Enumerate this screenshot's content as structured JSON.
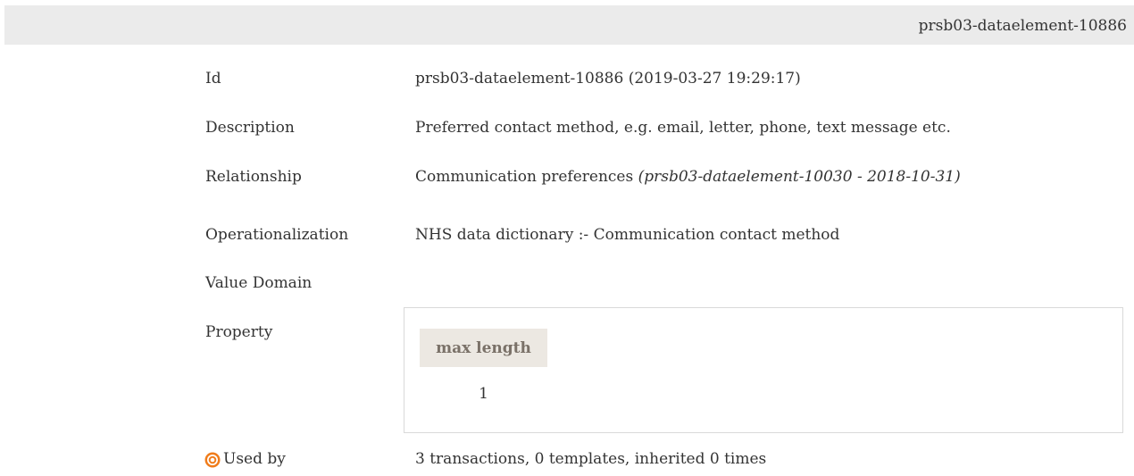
{
  "header": {
    "title": "prsb03-dataelement-10886"
  },
  "fields": {
    "id": {
      "label": "Id",
      "value": "prsb03-dataelement-10886 (2019-03-27 19:29:17)"
    },
    "description": {
      "label": "Description",
      "value": "Preferred contact method, e.g. email, letter, phone, text message etc."
    },
    "relationship": {
      "label": "Relationship",
      "value": "Communication preferences",
      "reference": "(prsb03-dataelement-10030 - 2018-10-31)"
    },
    "operationalization": {
      "label": "Operationalization",
      "value": "NHS data dictionary :- Communication contact method"
    },
    "value_domain": {
      "label": "Value Domain"
    },
    "property": {
      "label": "Property",
      "column_header": "max length",
      "column_value": "1"
    },
    "used_by": {
      "icon": "target-icon",
      "label": "Used by",
      "value": "3 transactions, 0 templates, inherited 0 times"
    }
  },
  "colors": {
    "header_bg": "#ebebeb",
    "property_header_bg": "#ece8e2",
    "property_header_text": "#7a7168",
    "icon_accent": "#f07c1b"
  }
}
